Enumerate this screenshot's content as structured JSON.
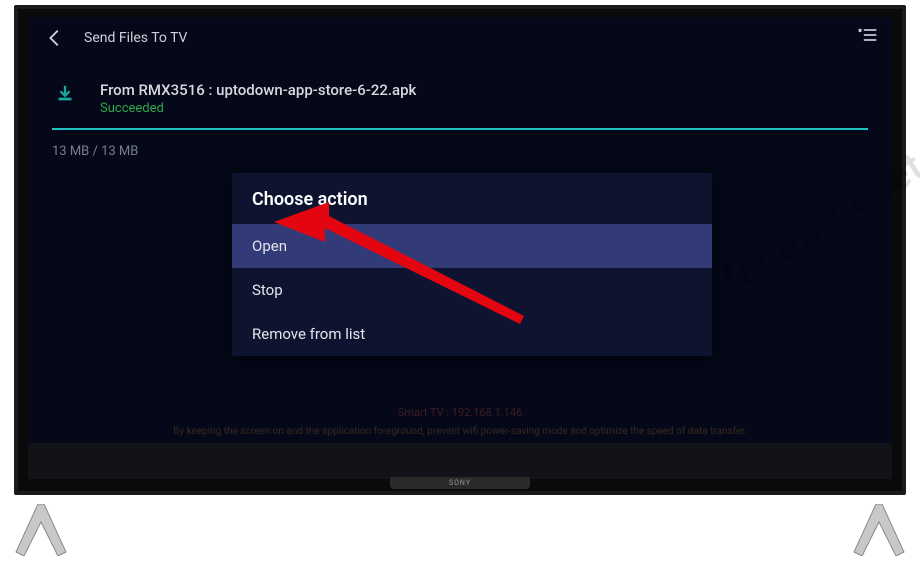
{
  "header": {
    "title": "Send Files To TV"
  },
  "file": {
    "title": "From RMX3516 : uptodown-app-store-6-22.apk",
    "status": "Succeeded",
    "size": "13 MB / 13 MB"
  },
  "dialog": {
    "title": "Choose action",
    "items": [
      {
        "label": "Open",
        "selected": true
      },
      {
        "label": "Stop",
        "selected": false
      },
      {
        "label": "Remove from list",
        "selected": false
      }
    ]
  },
  "footer": {
    "line1": "Smart TV : 192.168.1.146",
    "line2": "By keeping the screen on and the application foreground, prevent wifi power-saving mode and optimize the speed of data transfer."
  },
  "tv": {
    "brand": "SONY"
  },
  "watermark": "factoryreset.n"
}
